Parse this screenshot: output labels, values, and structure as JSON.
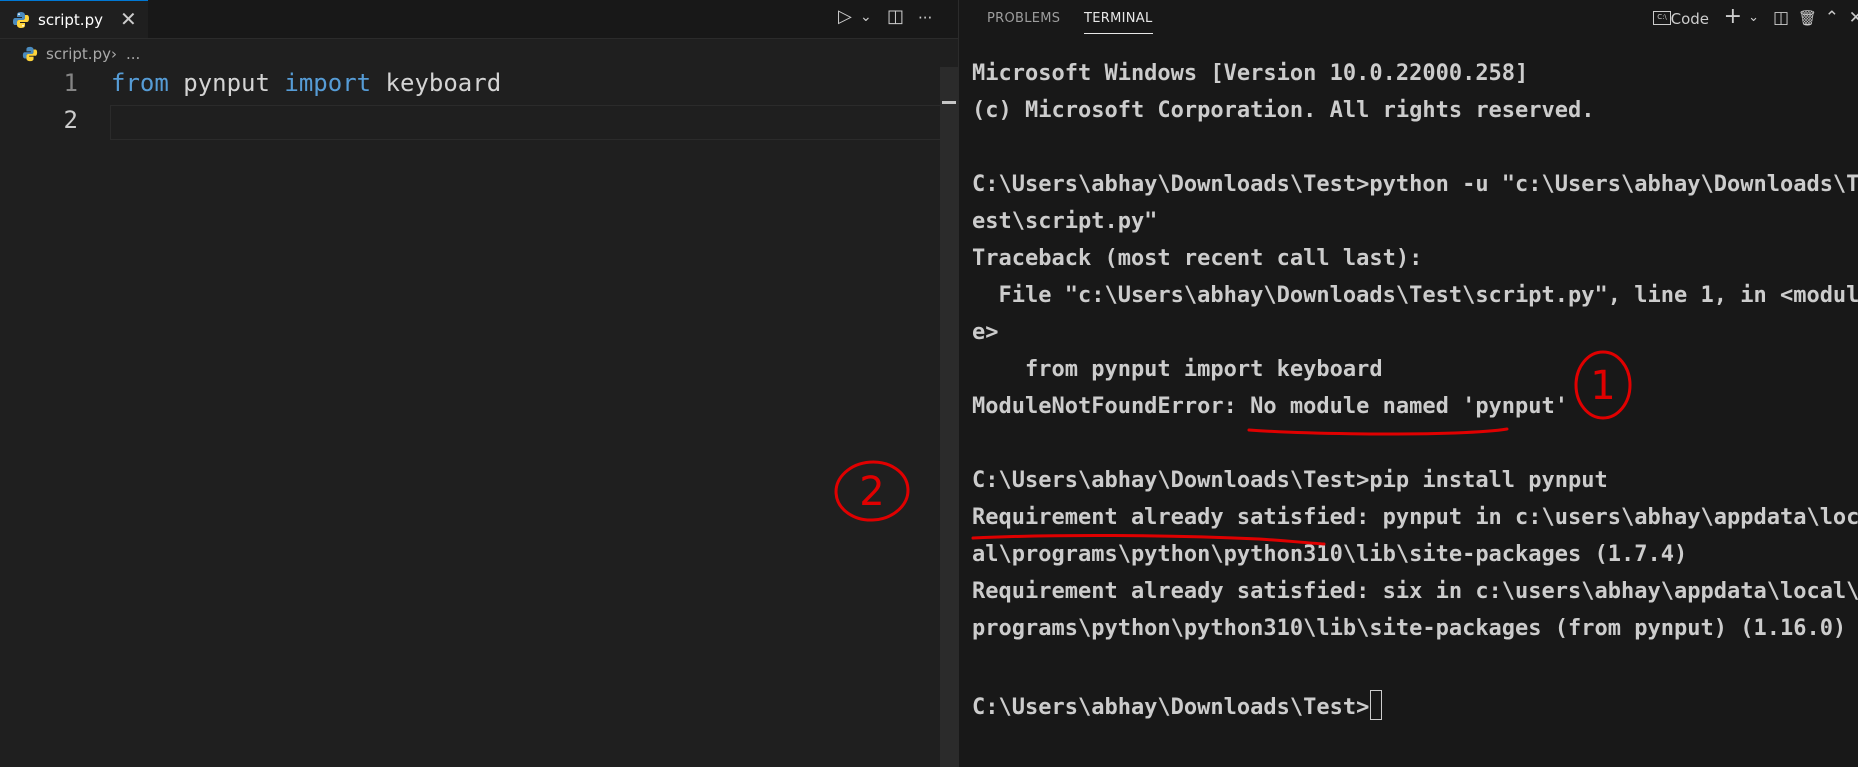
{
  "editor": {
    "tab": {
      "filename": "script.py",
      "close_glyph": "✕"
    },
    "actions": {
      "run_glyph": "▷",
      "run_dropdown_glyph": "⌄",
      "split_glyph": "◫",
      "more_glyph": "···"
    },
    "breadcrumb": {
      "file": "script.py",
      "separator": "›",
      "more": "..."
    },
    "lines": [
      {
        "number": "1",
        "tokens": [
          {
            "text": "from",
            "kind": "keyword"
          },
          {
            "text": " pynput ",
            "kind": "plain"
          },
          {
            "text": "import",
            "kind": "keyword"
          },
          {
            "text": " keyboard",
            "kind": "plain"
          }
        ]
      },
      {
        "number": "2",
        "tokens": []
      }
    ],
    "annotation": {
      "label": "2",
      "color": "#e00000"
    }
  },
  "panel": {
    "tabs": [
      {
        "label": "PROBLEMS",
        "active": false
      },
      {
        "label": "TERMINAL",
        "active": true
      }
    ],
    "terminal_icon_text": "C:\\",
    "terminal_name": "Code",
    "actions": {
      "add": "+",
      "add_dropdown": "⌄",
      "split": "◫",
      "kill": "🗑",
      "maximize": "⌃",
      "close": "✕"
    },
    "annotation": {
      "label": "1",
      "color": "#e00000"
    }
  },
  "terminal": {
    "lines": [
      "Microsoft Windows [Version 10.0.22000.258]",
      "(c) Microsoft Corporation. All rights reserved.",
      "",
      "C:\\Users\\abhay\\Downloads\\Test>python -u \"c:\\Users\\abhay\\Downloads\\T",
      "est\\script.py\"",
      "Traceback (most recent call last):",
      "  File \"c:\\Users\\abhay\\Downloads\\Test\\script.py\", line 1, in <modul",
      "e>",
      "    from pynput import keyboard",
      "ModuleNotFoundError: No module named 'pynput'",
      "",
      "C:\\Users\\abhay\\Downloads\\Test>pip install pynput",
      "Requirement already satisfied: pynput in c:\\users\\abhay\\appdata\\loc",
      "al\\programs\\python\\python310\\lib\\site-packages (1.7.4)",
      "Requirement already satisfied: six in c:\\users\\abhay\\appdata\\local\\",
      "programs\\python\\python310\\lib\\site-packages (from pynput) (1.16.0)",
      "",
      "C:\\Users\\abhay\\Downloads\\Test>"
    ]
  },
  "colors": {
    "keyword": "#569cd6",
    "text": "#d4d4d4",
    "annotation": "#e00000",
    "accent": "#0078d4"
  }
}
